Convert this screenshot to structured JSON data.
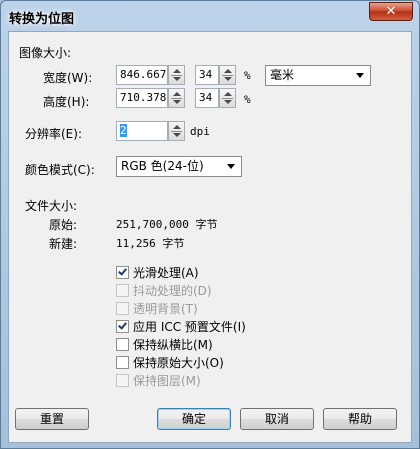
{
  "window": {
    "title": "转换为位图",
    "close_label": "✕"
  },
  "image_size": {
    "group_label": "图像大小:",
    "width_label": "宽度(W):",
    "width_value": "846.667",
    "width_percent": "34",
    "height_label": "高度(H):",
    "height_value": "710.378",
    "height_percent": "34",
    "percent_unit": "%",
    "unit_selected": "毫米"
  },
  "resolution": {
    "label": "分辨率(E):",
    "value": "2",
    "unit": "dpi"
  },
  "color_mode": {
    "label": "颜色模式(C):",
    "selected": "RGB 色(24-位)"
  },
  "file_size": {
    "group_label": "文件大小:",
    "original_label": "原始:",
    "original_value": "251,700,000 字节",
    "new_label": "新建:",
    "new_value": "11,256 字节"
  },
  "options": [
    {
      "label": "光滑处理(A)",
      "checked": true,
      "enabled": true
    },
    {
      "label": "抖动处理的(D)",
      "checked": false,
      "enabled": false
    },
    {
      "label": "透明背景(T)",
      "checked": false,
      "enabled": false
    },
    {
      "label": "应用 ICC 预置文件(I)",
      "checked": true,
      "enabled": true
    },
    {
      "label": "保持纵横比(M)",
      "checked": false,
      "enabled": true
    },
    {
      "label": "保持原始大小(O)",
      "checked": false,
      "enabled": true
    },
    {
      "label": "保持图层(M)",
      "checked": false,
      "enabled": false
    }
  ],
  "buttons": {
    "reset": "重置",
    "ok": "确定",
    "cancel": "取消",
    "help": "帮助"
  }
}
